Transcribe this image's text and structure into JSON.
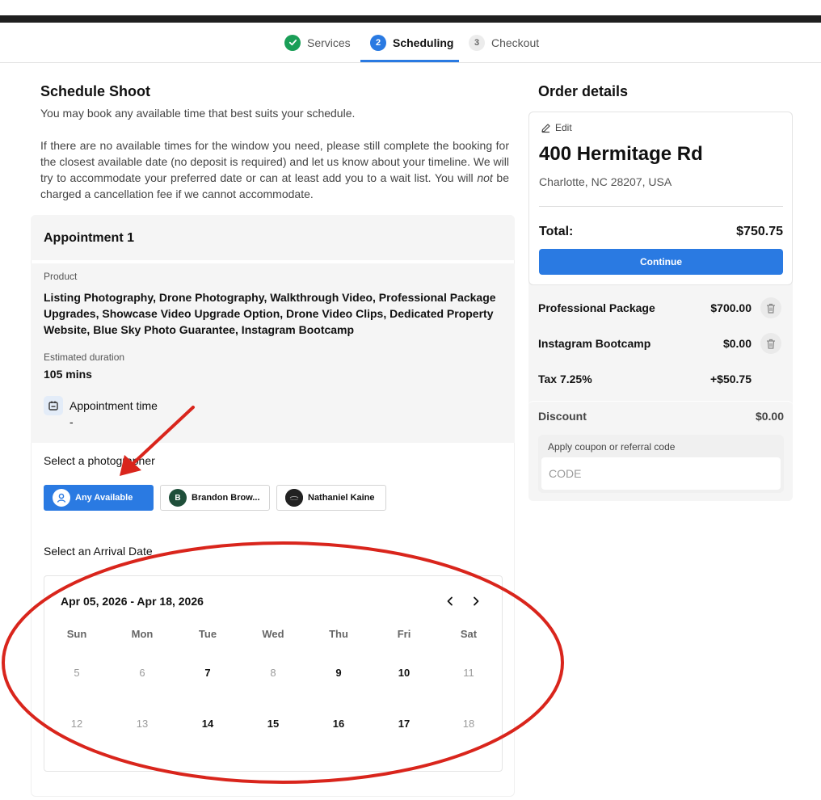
{
  "stepper": {
    "steps": [
      {
        "num": "✓",
        "label": "Services"
      },
      {
        "num": "2",
        "label": "Scheduling"
      },
      {
        "num": "3",
        "label": "Checkout"
      }
    ]
  },
  "schedule": {
    "title": "Schedule Shoot",
    "intro": "You may book any available time that best suits your schedule.",
    "intro2_a": "If there are no available times for the window you need, please still complete the booking for the closest available date (no deposit is required) and let us know about your timeline. We will try to accommodate your preferred date or can at least add you to a wait list. You will ",
    "intro2_em": "not",
    "intro2_b": " be charged a cancellation fee if we cannot accommodate."
  },
  "appointment": {
    "title": "Appointment 1",
    "product_label": "Product",
    "products": "Listing Photography, Drone Photography, Walkthrough Video, Professional Package Upgrades, Showcase Video Upgrade Option, Drone Video Clips, Dedicated Property Website, Blue Sky Photo Guarantee, Instagram Bootcamp",
    "duration_label": "Estimated duration",
    "duration": "105 mins",
    "time_label": "Appointment time",
    "time_value": "-",
    "photographer_label": "Select a photographer",
    "photographers": [
      {
        "initial": "",
        "name": "Any Available"
      },
      {
        "initial": "B",
        "name": "Brandon Brow..."
      },
      {
        "initial": "",
        "name": "Nathaniel Kaine"
      }
    ],
    "arrival_label": "Select an Arrival Date"
  },
  "calendar": {
    "range": "Apr 05, 2026 - Apr 18, 2026",
    "weekdays": [
      "Sun",
      "Mon",
      "Tue",
      "Wed",
      "Thu",
      "Fri",
      "Sat"
    ],
    "weeks": [
      [
        {
          "d": "5",
          "available": false
        },
        {
          "d": "6",
          "available": false
        },
        {
          "d": "7",
          "available": true
        },
        {
          "d": "8",
          "available": false
        },
        {
          "d": "9",
          "available": true
        },
        {
          "d": "10",
          "available": true
        },
        {
          "d": "11",
          "available": false
        }
      ],
      [
        {
          "d": "12",
          "available": false
        },
        {
          "d": "13",
          "available": false
        },
        {
          "d": "14",
          "available": true
        },
        {
          "d": "15",
          "available": true
        },
        {
          "d": "16",
          "available": true
        },
        {
          "d": "17",
          "available": true
        },
        {
          "d": "18",
          "available": false
        }
      ]
    ]
  },
  "order": {
    "title": "Order details",
    "edit_label": "Edit",
    "address_line1": "400 Hermitage Rd",
    "address_line2": "Charlotte, NC 28207, USA",
    "total_label": "Total:",
    "total_value": "$750.75",
    "continue_label": "Continue",
    "items": [
      {
        "name": "Professional Package",
        "price": "$700.00"
      },
      {
        "name": "Instagram Bootcamp",
        "price": "$0.00"
      }
    ],
    "tax_label": "Tax 7.25%",
    "tax_value": "+$50.75",
    "discount_label": "Discount",
    "discount_value": "$0.00",
    "coupon_label": "Apply coupon or referral code",
    "coupon_placeholder": "CODE"
  },
  "colors": {
    "accent": "#2a7ae2",
    "success": "#1a9e57",
    "annotation": "#d9251c"
  }
}
